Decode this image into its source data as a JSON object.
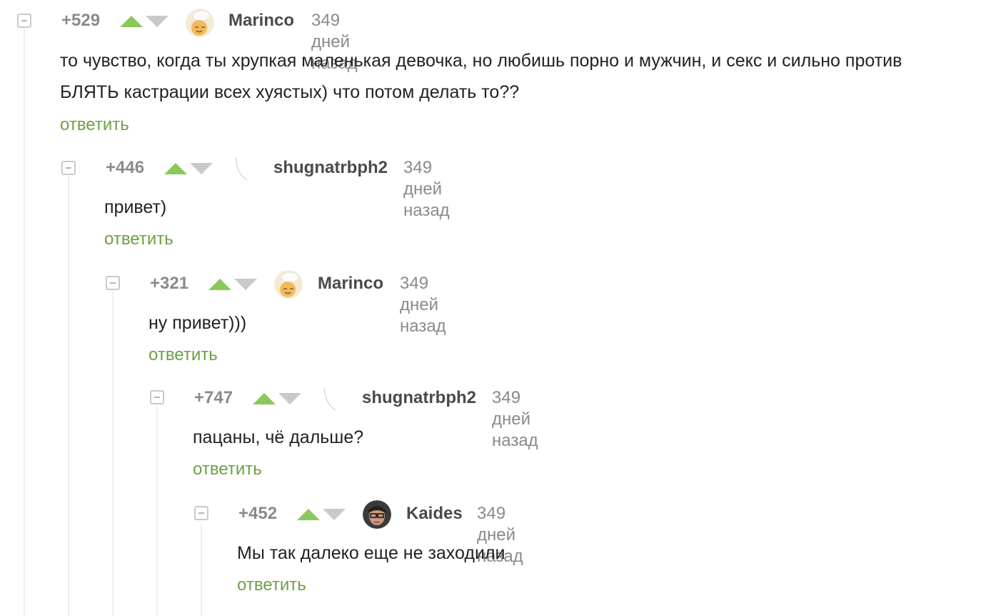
{
  "comments": [
    {
      "rating": "+529",
      "author": "Marinco",
      "avatar": "chef-avatar-icon",
      "time": "349 дней назад",
      "text": "то чувство, когда ты хрупкая маленькая девочка, но любишь порно и мужчин, и секс и сильно против БЛЯТЬ кастрации всех хуястых) что потом делать то??",
      "reply": "ответить"
    },
    {
      "rating": "+446",
      "author": "shugnatrbph2",
      "avatar": "empty-avatar-icon",
      "time": "349 дней назад",
      "text": "привет)",
      "reply": "ответить"
    },
    {
      "rating": "+321",
      "author": "Marinco",
      "avatar": "chef-avatar-icon",
      "time": "349 дней назад",
      "text": "ну привет)))",
      "reply": "ответить"
    },
    {
      "rating": "+747",
      "author": "shugnatrbph2",
      "avatar": "empty-avatar-icon",
      "time": "349 дней назад",
      "text": "пацаны, чё дальше?",
      "reply": "ответить"
    },
    {
      "rating": "+452",
      "author": "Kaides",
      "avatar": "photo-avatar-icon",
      "time": "349 дней назад",
      "text": "Мы так далеко еще не заходили",
      "reply": "ответить"
    }
  ],
  "colors": {
    "upvote": "#8ac858",
    "downvote": "#c9c9c9",
    "reply": "#6ea043",
    "meta": "#8a8a8a"
  }
}
